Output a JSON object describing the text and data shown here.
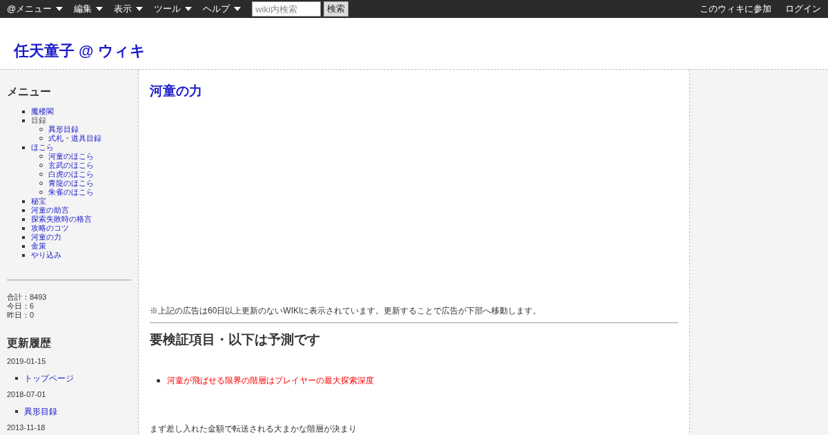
{
  "topbar": {
    "menus": [
      "@メニュー",
      "編集",
      "表示",
      "ツール",
      "ヘルプ"
    ],
    "search": {
      "placeholder": "wiki内検索",
      "button": "検索"
    },
    "right_links": [
      "このウィキに参加",
      "ログイン"
    ]
  },
  "site_title": "任天童子 @ ウィキ",
  "sidebar": {
    "heading": "メニュー",
    "items": [
      {
        "label": "魔楼閣",
        "link": true
      },
      {
        "label": "目録",
        "link": false,
        "children": [
          {
            "label": "異形目録",
            "link": true
          },
          {
            "label": "式札・道具目録",
            "link": true
          }
        ]
      },
      {
        "label": "ほこら",
        "link": true,
        "children": [
          {
            "label": "河童のほこら",
            "link": true
          },
          {
            "label": "玄武のほこら",
            "link": true
          },
          {
            "label": "白虎のほこら",
            "link": true
          },
          {
            "label": "青龍のほこら",
            "link": true
          },
          {
            "label": "朱雀のほこら",
            "link": true
          }
        ]
      },
      {
        "label": "秘宝",
        "link": true
      },
      {
        "label": "河童の助言",
        "link": true
      },
      {
        "label": "探索失敗時の格言",
        "link": true
      },
      {
        "label": "攻略のコツ",
        "link": true
      },
      {
        "label": "河童の力",
        "link": true
      },
      {
        "label": "金策",
        "link": true
      },
      {
        "label": "やり込み",
        "link": true
      }
    ],
    "counter": [
      "合計：8493",
      "今日：6",
      "昨日：0"
    ],
    "history_heading": "更新履歴",
    "history": [
      {
        "date": "2019-01-15",
        "pages": [
          "トップページ"
        ]
      },
      {
        "date": "2018-07-01",
        "pages": [
          "異形目録"
        ]
      },
      {
        "date": "2013-11-18"
      }
    ]
  },
  "main": {
    "page_title": "河童の力",
    "ad_note": "※上記の広告は60日以上更新のないWIKIに表示されています。更新することで広告が下部へ移動します。",
    "heading": "要検証項目・以下は予測です",
    "bullets": [
      {
        "text": "河童が飛ばせる限界の階層はプレイヤーの最大探索深度",
        "color": "#ff0000"
      }
    ],
    "paragraph": "まず差し入れた金額で転送される大まかな階層が決まり"
  }
}
